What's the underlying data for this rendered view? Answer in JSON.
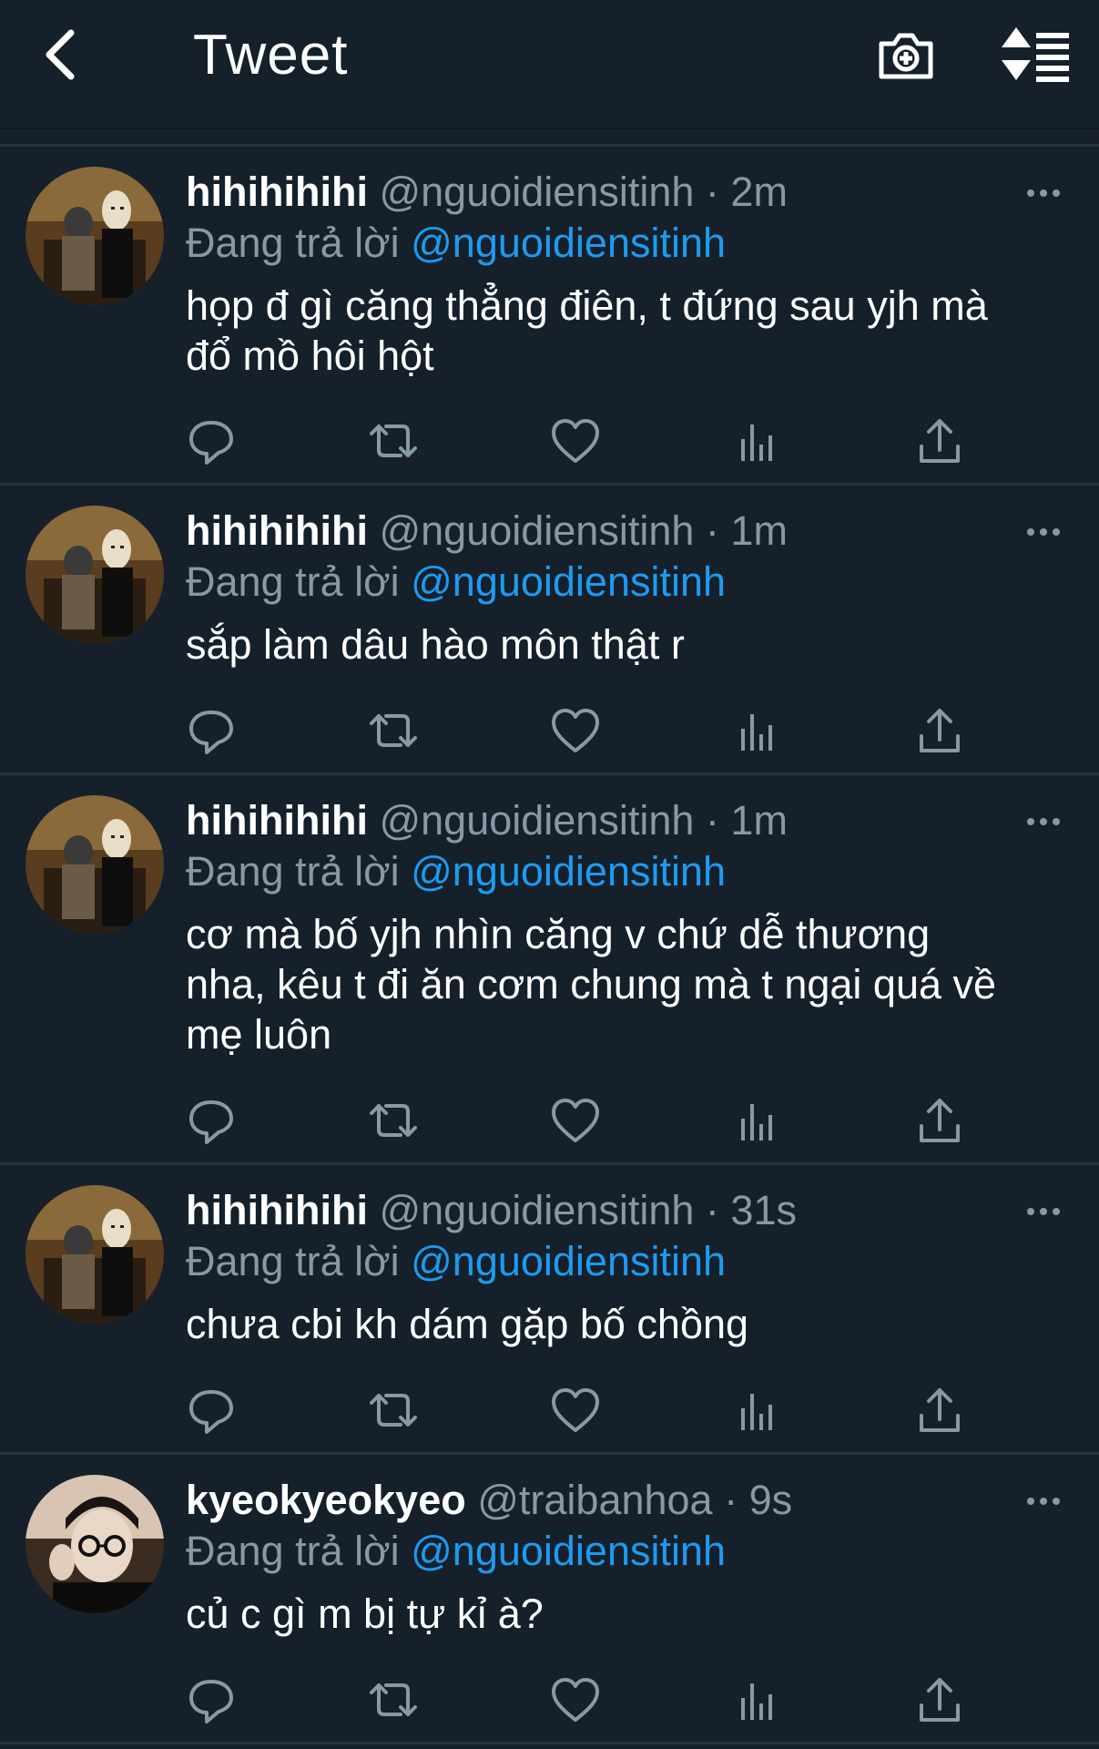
{
  "header": {
    "title": "Tweet",
    "icons": [
      "back-chevron-icon",
      "camera-add-icon",
      "sort-icon"
    ]
  },
  "colors": {
    "background": "#15202b",
    "divider": "#263442",
    "secondary_text": "#8899a6",
    "accent": "#1d9bf0"
  },
  "tweets": [
    {
      "name": "hihihihihi",
      "handle": "@nguoidiensitinh",
      "separator": "·",
      "time": "2m",
      "reply_prefix": "Đang trả lời ",
      "reply_to": "@nguoidiensitinh",
      "lines": [
        "họp đ gì căng thẳng điên, t đứng sau yjh mà",
        "đổ mồ hôi hột"
      ]
    },
    {
      "name": "hihihihihi",
      "handle": "@nguoidiensitinh",
      "separator": "·",
      "time": "1m",
      "reply_prefix": "Đang trả lời ",
      "reply_to": "@nguoidiensitinh",
      "lines": [
        "sắp làm dâu hào môn thật r"
      ]
    },
    {
      "name": "hihihihihi",
      "handle": "@nguoidiensitinh",
      "separator": "·",
      "time": "1m",
      "reply_prefix": "Đang trả lời ",
      "reply_to": "@nguoidiensitinh",
      "lines": [
        "cơ mà bố yjh nhìn căng v chứ dễ thương",
        "nha, kêu t đi ăn cơm chung mà t ngại quá về",
        "mẹ luôn"
      ]
    },
    {
      "name": "hihihihihi",
      "handle": "@nguoidiensitinh",
      "separator": "·",
      "time": "31s",
      "reply_prefix": "Đang trả lời ",
      "reply_to": "@nguoidiensitinh",
      "lines": [
        "chưa cbi kh dám gặp bố chồng"
      ]
    },
    {
      "name": "kyeokyeokyeo",
      "handle": "@traibanhoa",
      "separator": "·",
      "time": "9s",
      "reply_prefix": "Đang trả lời ",
      "reply_to": "@nguoidiensitinh",
      "lines": [
        "củ c gì m bị tự kỉ à?"
      ]
    }
  ],
  "action_icons": [
    "reply-icon",
    "retweet-icon",
    "like-icon",
    "analytics-icon",
    "share-icon"
  ]
}
